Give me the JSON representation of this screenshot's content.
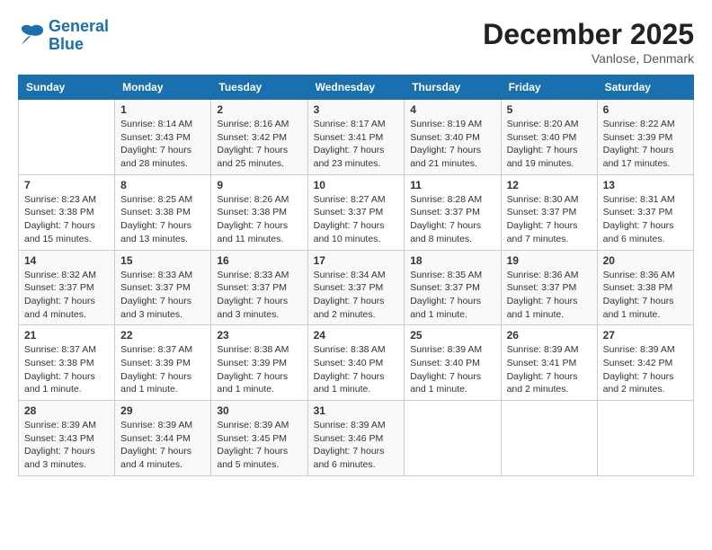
{
  "header": {
    "logo_line1": "General",
    "logo_line2": "Blue",
    "month_title": "December 2025",
    "location": "Vanlose, Denmark"
  },
  "weekdays": [
    "Sunday",
    "Monday",
    "Tuesday",
    "Wednesday",
    "Thursday",
    "Friday",
    "Saturday"
  ],
  "weeks": [
    [
      {
        "num": "",
        "info": ""
      },
      {
        "num": "1",
        "info": "Sunrise: 8:14 AM\nSunset: 3:43 PM\nDaylight: 7 hours\nand 28 minutes."
      },
      {
        "num": "2",
        "info": "Sunrise: 8:16 AM\nSunset: 3:42 PM\nDaylight: 7 hours\nand 25 minutes."
      },
      {
        "num": "3",
        "info": "Sunrise: 8:17 AM\nSunset: 3:41 PM\nDaylight: 7 hours\nand 23 minutes."
      },
      {
        "num": "4",
        "info": "Sunrise: 8:19 AM\nSunset: 3:40 PM\nDaylight: 7 hours\nand 21 minutes."
      },
      {
        "num": "5",
        "info": "Sunrise: 8:20 AM\nSunset: 3:40 PM\nDaylight: 7 hours\nand 19 minutes."
      },
      {
        "num": "6",
        "info": "Sunrise: 8:22 AM\nSunset: 3:39 PM\nDaylight: 7 hours\nand 17 minutes."
      }
    ],
    [
      {
        "num": "7",
        "info": "Sunrise: 8:23 AM\nSunset: 3:38 PM\nDaylight: 7 hours\nand 15 minutes."
      },
      {
        "num": "8",
        "info": "Sunrise: 8:25 AM\nSunset: 3:38 PM\nDaylight: 7 hours\nand 13 minutes."
      },
      {
        "num": "9",
        "info": "Sunrise: 8:26 AM\nSunset: 3:38 PM\nDaylight: 7 hours\nand 11 minutes."
      },
      {
        "num": "10",
        "info": "Sunrise: 8:27 AM\nSunset: 3:37 PM\nDaylight: 7 hours\nand 10 minutes."
      },
      {
        "num": "11",
        "info": "Sunrise: 8:28 AM\nSunset: 3:37 PM\nDaylight: 7 hours\nand 8 minutes."
      },
      {
        "num": "12",
        "info": "Sunrise: 8:30 AM\nSunset: 3:37 PM\nDaylight: 7 hours\nand 7 minutes."
      },
      {
        "num": "13",
        "info": "Sunrise: 8:31 AM\nSunset: 3:37 PM\nDaylight: 7 hours\nand 6 minutes."
      }
    ],
    [
      {
        "num": "14",
        "info": "Sunrise: 8:32 AM\nSunset: 3:37 PM\nDaylight: 7 hours\nand 4 minutes."
      },
      {
        "num": "15",
        "info": "Sunrise: 8:33 AM\nSunset: 3:37 PM\nDaylight: 7 hours\nand 3 minutes."
      },
      {
        "num": "16",
        "info": "Sunrise: 8:33 AM\nSunset: 3:37 PM\nDaylight: 7 hours\nand 3 minutes."
      },
      {
        "num": "17",
        "info": "Sunrise: 8:34 AM\nSunset: 3:37 PM\nDaylight: 7 hours\nand 2 minutes."
      },
      {
        "num": "18",
        "info": "Sunrise: 8:35 AM\nSunset: 3:37 PM\nDaylight: 7 hours\nand 1 minute."
      },
      {
        "num": "19",
        "info": "Sunrise: 8:36 AM\nSunset: 3:37 PM\nDaylight: 7 hours\nand 1 minute."
      },
      {
        "num": "20",
        "info": "Sunrise: 8:36 AM\nSunset: 3:38 PM\nDaylight: 7 hours\nand 1 minute."
      }
    ],
    [
      {
        "num": "21",
        "info": "Sunrise: 8:37 AM\nSunset: 3:38 PM\nDaylight: 7 hours\nand 1 minute."
      },
      {
        "num": "22",
        "info": "Sunrise: 8:37 AM\nSunset: 3:39 PM\nDaylight: 7 hours\nand 1 minute."
      },
      {
        "num": "23",
        "info": "Sunrise: 8:38 AM\nSunset: 3:39 PM\nDaylight: 7 hours\nand 1 minute."
      },
      {
        "num": "24",
        "info": "Sunrise: 8:38 AM\nSunset: 3:40 PM\nDaylight: 7 hours\nand 1 minute."
      },
      {
        "num": "25",
        "info": "Sunrise: 8:39 AM\nSunset: 3:40 PM\nDaylight: 7 hours\nand 1 minute."
      },
      {
        "num": "26",
        "info": "Sunrise: 8:39 AM\nSunset: 3:41 PM\nDaylight: 7 hours\nand 2 minutes."
      },
      {
        "num": "27",
        "info": "Sunrise: 8:39 AM\nSunset: 3:42 PM\nDaylight: 7 hours\nand 2 minutes."
      }
    ],
    [
      {
        "num": "28",
        "info": "Sunrise: 8:39 AM\nSunset: 3:43 PM\nDaylight: 7 hours\nand 3 minutes."
      },
      {
        "num": "29",
        "info": "Sunrise: 8:39 AM\nSunset: 3:44 PM\nDaylight: 7 hours\nand 4 minutes."
      },
      {
        "num": "30",
        "info": "Sunrise: 8:39 AM\nSunset: 3:45 PM\nDaylight: 7 hours\nand 5 minutes."
      },
      {
        "num": "31",
        "info": "Sunrise: 8:39 AM\nSunset: 3:46 PM\nDaylight: 7 hours\nand 6 minutes."
      },
      {
        "num": "",
        "info": ""
      },
      {
        "num": "",
        "info": ""
      },
      {
        "num": "",
        "info": ""
      }
    ]
  ]
}
